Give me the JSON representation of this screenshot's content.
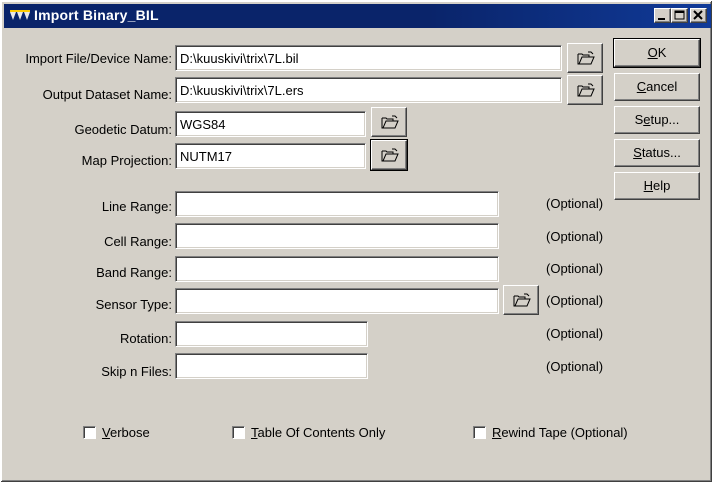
{
  "window": {
    "title": "Import Binary_BIL"
  },
  "fields": {
    "import_file": {
      "label": "Import File/Device Name:",
      "value": "D:\\kuuskivi\\trix\\7L.bil"
    },
    "output_dataset": {
      "label": "Output Dataset Name:",
      "value": "D:\\kuuskivi\\trix\\7L.ers"
    },
    "geodetic_datum": {
      "label": "Geodetic Datum:",
      "value": "WGS84"
    },
    "map_projection": {
      "label": "Map Projection:",
      "value": "NUTM17"
    },
    "line_range": {
      "label": "Line Range:",
      "value": "",
      "note": "(Optional)"
    },
    "cell_range": {
      "label": "Cell Range:",
      "value": "",
      "note": "(Optional)"
    },
    "band_range": {
      "label": "Band Range:",
      "value": "",
      "note": "(Optional)"
    },
    "sensor_type": {
      "label": "Sensor Type:",
      "value": "",
      "note": "(Optional)"
    },
    "rotation": {
      "label": "Rotation:",
      "value": "",
      "note": "(Optional)"
    },
    "skip_n_files": {
      "label": "Skip n Files:",
      "value": "",
      "note": "(Optional)"
    }
  },
  "buttons": {
    "ok": {
      "mnemonic": "O",
      "rest": "K"
    },
    "cancel": {
      "mnemonic": "C",
      "rest": "ancel"
    },
    "setup": {
      "pre": "S",
      "mnemonic": "e",
      "rest": "tup..."
    },
    "status": {
      "mnemonic": "S",
      "rest": "tatus..."
    },
    "help": {
      "mnemonic": "H",
      "rest": "elp"
    }
  },
  "checkboxes": {
    "verbose": {
      "mnemonic": "V",
      "rest": "erbose",
      "checked": false
    },
    "toc_only": {
      "mnemonic": "T",
      "rest": "able Of Contents Only",
      "checked": false
    },
    "rewind_tape": {
      "mnemonic": "R",
      "rest": "ewind Tape",
      "note": "(Optional)",
      "checked": false
    }
  },
  "icons": {
    "browse": "open-folder-icon",
    "app": "app-logo-icon"
  },
  "colors": {
    "titlebar": "#0a246a",
    "face": "#d4d0c8"
  }
}
